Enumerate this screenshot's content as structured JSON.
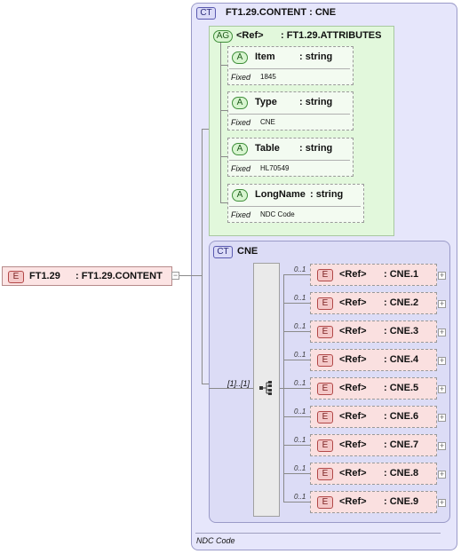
{
  "root_element": {
    "badge": "E",
    "name": "FT1.29",
    "type": ": FT1.29.CONTENT"
  },
  "content_type": {
    "badge": "CT",
    "name": "FT1.29.CONTENT : CNE",
    "footer": "NDC Code"
  },
  "attribute_group": {
    "badge": "AG",
    "ref": "<Ref>",
    "type": ": FT1.29.ATTRIBUTES",
    "attributes": [
      {
        "badge": "A",
        "name": "Item",
        "type": ": string",
        "fixed_label": "Fixed",
        "fixed_value": "1845"
      },
      {
        "badge": "A",
        "name": "Type",
        "type": ": string",
        "fixed_label": "Fixed",
        "fixed_value": "CNE"
      },
      {
        "badge": "A",
        "name": "Table",
        "type": ": string",
        "fixed_label": "Fixed",
        "fixed_value": "HL70549"
      },
      {
        "badge": "A",
        "name": "LongName",
        "type": ": string",
        "fixed_label": "Fixed",
        "fixed_value": "NDC Code"
      }
    ]
  },
  "cne_type": {
    "badge": "CT",
    "name": "CNE",
    "sequence_cardinality": "[1]..[1]"
  },
  "cne_elements": [
    {
      "badge": "E",
      "ref": "<Ref>",
      "type": ": CNE.1",
      "card": "0..1"
    },
    {
      "badge": "E",
      "ref": "<Ref>",
      "type": ": CNE.2",
      "card": "0..1"
    },
    {
      "badge": "E",
      "ref": "<Ref>",
      "type": ": CNE.3",
      "card": "0..1"
    },
    {
      "badge": "E",
      "ref": "<Ref>",
      "type": ": CNE.4",
      "card": "0..1"
    },
    {
      "badge": "E",
      "ref": "<Ref>",
      "type": ": CNE.5",
      "card": "0..1"
    },
    {
      "badge": "E",
      "ref": "<Ref>",
      "type": ": CNE.6",
      "card": "0..1"
    },
    {
      "badge": "E",
      "ref": "<Ref>",
      "type": ": CNE.7",
      "card": "0..1"
    },
    {
      "badge": "E",
      "ref": "<Ref>",
      "type": ": CNE.8",
      "card": "0..1"
    },
    {
      "badge": "E",
      "ref": "<Ref>",
      "type": ": CNE.9",
      "card": "0..1"
    }
  ]
}
